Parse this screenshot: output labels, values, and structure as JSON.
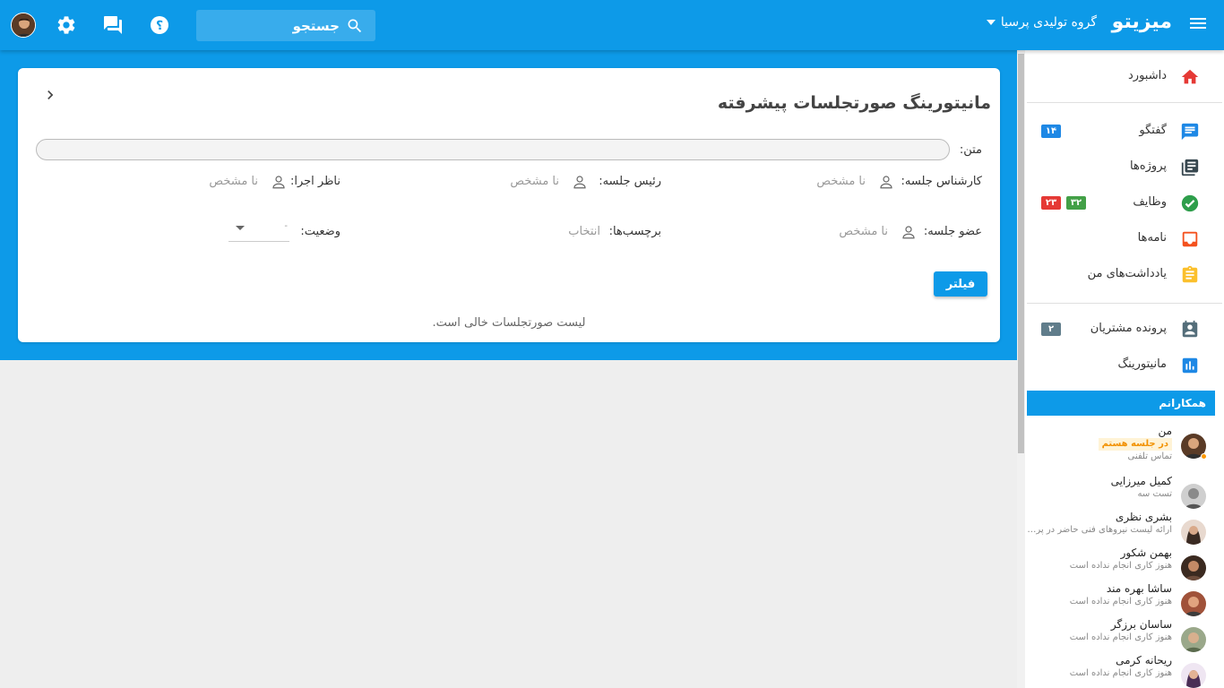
{
  "header": {
    "brand": "میزیتو",
    "organization": "گروه تولیدی پرسیا",
    "search_placeholder": "جستجو",
    "icons": [
      "menu-icon",
      "search-icon",
      "help-icon",
      "chat-icon",
      "gear-icon"
    ]
  },
  "page": {
    "title": "مانیتورینگ صورتجلسات پیشرفته",
    "filters": {
      "text_label": "متن:",
      "expert_label": "کارشناس جلسه:",
      "expert_value": "نا مشخص",
      "chair_label": "رئیس جلسه:",
      "chair_value": "نا مشخص",
      "supervisor_label": "ناظر اجرا:",
      "supervisor_value": "نا مشخص",
      "member_label": "عضو جلسه:",
      "member_value": "نا مشخص",
      "tags_label": "برچسب‌ها:",
      "tags_value": "انتخاب",
      "status_label": "وضعیت:",
      "status_value": "-"
    },
    "filter_button": "فیلتر",
    "empty_message": "لیست صورتجلسات خالی است."
  },
  "sidebar": {
    "items": [
      {
        "label": "داشبورد",
        "icon": "home-icon"
      },
      {
        "label": "گفتگو",
        "icon": "chat-icon",
        "badge": "۱۴"
      },
      {
        "label": "پروژه‌ها",
        "icon": "projects-icon"
      },
      {
        "label": "وظایف",
        "icon": "tasks-icon",
        "badge_green": "۳۲",
        "badge_red": "۲۳"
      },
      {
        "label": "نامه‌ها",
        "icon": "letters-icon"
      },
      {
        "label": "یادداشت‌های من",
        "icon": "notes-icon"
      },
      {
        "label": "پرونده مشتریان",
        "icon": "customers-icon",
        "badge": "۲"
      },
      {
        "label": "مانیتورینگ",
        "icon": "monitoring-icon"
      }
    ],
    "colleagues_title": "همکارانم",
    "colleagues": [
      {
        "name": "من",
        "session": "در جلسه هستم",
        "status": "تماس تلفنی"
      },
      {
        "name": "کمیل میرزایی",
        "status": "تست سه"
      },
      {
        "name": "بشری نظری",
        "status": "ارائه لیست نیروهای فنی حاضر در پروژه"
      },
      {
        "name": "بهمن شکور",
        "status": "هنوز کاری انجام نداده است"
      },
      {
        "name": "ساشا بهره مند",
        "status": "هنوز کاری انجام نداده است"
      },
      {
        "name": "ساسان برزگر",
        "status": "هنوز کاری انجام نداده است"
      },
      {
        "name": "ریحانه کرمی",
        "status": "هنوز کاری انجام نداده است"
      }
    ]
  },
  "colors": {
    "primary": "#0d9ae8",
    "badge_blue": "#1e88e5",
    "badge_green": "#43a047",
    "badge_red": "#e53935",
    "badge_grey": "#607d8b"
  }
}
